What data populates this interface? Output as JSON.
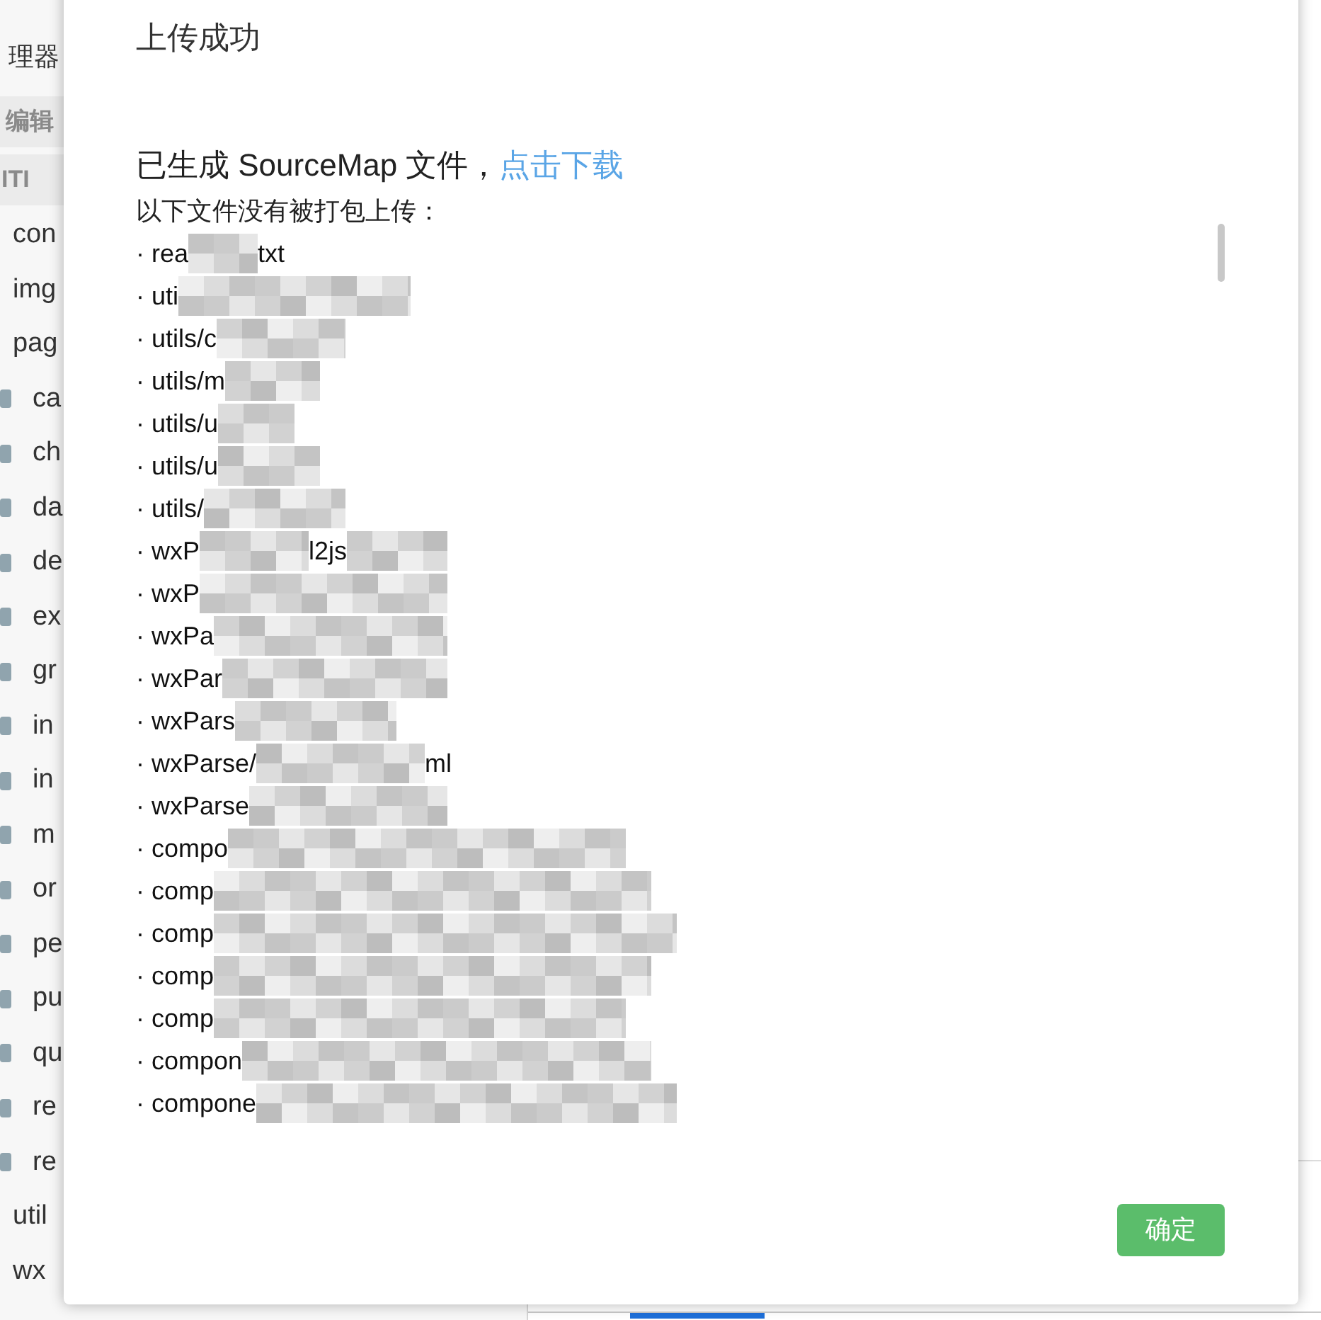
{
  "sidebar": {
    "title": "理器",
    "sections": [
      {
        "label": "编辑"
      },
      {
        "label": "ITI"
      }
    ],
    "tree": [
      {
        "label": "con"
      },
      {
        "label": "img"
      },
      {
        "label": "pag",
        "children": [
          {
            "label": "ca"
          },
          {
            "label": "ch"
          },
          {
            "label": "da"
          },
          {
            "label": "de"
          },
          {
            "label": "ex"
          },
          {
            "label": "gr"
          },
          {
            "label": "in"
          },
          {
            "label": "in"
          },
          {
            "label": "m"
          },
          {
            "label": "or"
          },
          {
            "label": "pe"
          },
          {
            "label": "pu"
          },
          {
            "label": "qu"
          },
          {
            "label": "re"
          },
          {
            "label": "re"
          }
        ]
      },
      {
        "label": "util"
      },
      {
        "label": "wx"
      }
    ]
  },
  "dialog": {
    "title": "上传成功",
    "message": "已生成 SourceMap 文件，",
    "download_link": "点击下载",
    "note": "以下文件没有被打包上传：",
    "files": [
      {
        "text": "· rea",
        "tail": "txt"
      },
      {
        "text": "· uti"
      },
      {
        "text": "· utils/c"
      },
      {
        "text": "· utils/m"
      },
      {
        "text": "· utils/u"
      },
      {
        "text": "· utils/u"
      },
      {
        "text": "· utils/"
      },
      {
        "text": "· wxP",
        "tail": "l2js"
      },
      {
        "text": "· wxP"
      },
      {
        "text": "· wxPa"
      },
      {
        "text": "· wxPar"
      },
      {
        "text": "· wxPars"
      },
      {
        "text": "· wxParse/",
        "tail": "ml"
      },
      {
        "text": "· wxParse"
      },
      {
        "text": "· compo"
      },
      {
        "text": "· comp"
      },
      {
        "text": "· comp"
      },
      {
        "text": "· comp"
      },
      {
        "text": "· comp"
      },
      {
        "text": "· compon"
      },
      {
        "text": "· compone"
      }
    ],
    "buttons": [
      {
        "label": "确定",
        "kind": "primary"
      }
    ]
  },
  "bottom_panel": {
    "tabs": [
      {
        "selected": true
      }
    ]
  }
}
